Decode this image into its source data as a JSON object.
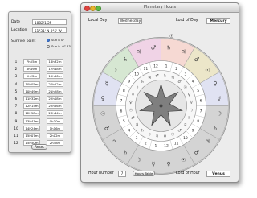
{
  "sunrise_window": {
    "date_label": "Date",
    "date_value": "1882/1/25",
    "location_label": "Location",
    "location_value": "51°31' N 0°5' W",
    "sunrise_point_label": "Sunrise point",
    "radio_options": [
      "Sun h 0°",
      "Sun h -0°.83"
    ],
    "rows": [
      {
        "n": "1",
        "a": "7h55m",
        "b": "16h32m"
      },
      {
        "n": "2",
        "a": "8h49m",
        "b": "17h48m"
      },
      {
        "n": "3",
        "a": "9h22m",
        "b": "19h00m"
      },
      {
        "n": "4",
        "a": "10h05m",
        "b": "20h22m"
      },
      {
        "n": "5",
        "a": "10h49m",
        "b": "21h28m"
      },
      {
        "n": "6",
        "a": "11h32m",
        "b": "22h08m"
      },
      {
        "n": "7",
        "a": "12h15m",
        "b": "22h56m"
      },
      {
        "n": "8",
        "a": "12h58m",
        "b": "23h44m"
      },
      {
        "n": "9",
        "a": "13h41m",
        "b": "0h30m"
      },
      {
        "n": "10",
        "a": "14h24m",
        "b": "1h16m"
      },
      {
        "n": "11",
        "a": "15h07m",
        "b": "2h02m"
      },
      {
        "n": "12",
        "a": "15h50m",
        "b": "2h48m"
      }
    ],
    "reset_label": "Reset"
  },
  "main_window": {
    "title": "Planetary Hours",
    "local_day_label": "Local Day",
    "local_day_value": "Wednesday",
    "lord_of_day_label": "Lord of Day",
    "lord_of_day_value": "Mercury",
    "hour_number_label": "Hour number",
    "hour_number_value": "7",
    "hours_table_button": "Hours Table",
    "lord_of_hour_label": "Lord of Hour",
    "lord_of_hour_value": "Venus",
    "current_marker": "☉"
  },
  "wheel": {
    "outer_symbols": [
      "♄",
      "♃",
      "♂",
      "☉",
      "♀",
      "☿",
      "☽",
      "♄",
      "♃",
      "♂",
      "☉",
      "♀",
      "☿",
      "☽",
      "♄",
      "♃",
      "♂",
      "☉",
      "♀",
      "☿",
      "☽",
      "♄",
      "♃",
      "♂"
    ],
    "hour_numbers": [
      "1",
      "2",
      "3",
      "4",
      "5",
      "6",
      "7",
      "8",
      "9",
      "10",
      "11",
      "12",
      "1",
      "2",
      "3",
      "4",
      "5",
      "6",
      "7",
      "8",
      "9",
      "10",
      "11",
      "12"
    ],
    "inner_symbols": [
      "♄",
      "♃",
      "♂",
      "☉",
      "♀",
      "☿",
      "☽",
      "♄",
      "♃",
      "♂",
      "☉",
      "♀",
      "☿",
      "☽",
      "♄",
      "♃",
      "♂",
      "☉",
      "♀",
      "☿",
      "☽",
      "♄",
      "♃",
      "♂"
    ],
    "segment_colors": [
      "#f6d9d3",
      "#ece6c9",
      "#e0e2f2",
      "#d6e7d2",
      "#f0d3e6",
      "#d9ecf0",
      "#efe9cf",
      "#f6d9d3",
      "#ece6c9",
      "#e0e2f2",
      "#d6e7d2",
      "#f0d3e6"
    ],
    "night_shade": "#d4d4d4"
  }
}
